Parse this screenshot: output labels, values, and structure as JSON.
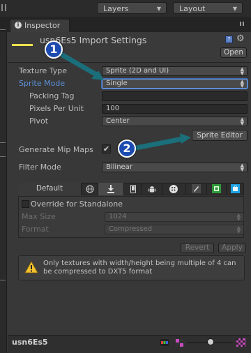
{
  "toolbar": {
    "layers_label": "Layers",
    "layout_label": "Layout"
  },
  "tab": {
    "label": "Inspector"
  },
  "header": {
    "title": "usn6Es5 Import Settings",
    "open_label": "Open"
  },
  "settings": {
    "texture_type": {
      "label": "Texture Type",
      "value": "Sprite (2D and UI)"
    },
    "sprite_mode": {
      "label": "Sprite Mode",
      "value": "Single"
    },
    "packing_tag": {
      "label": "Packing Tag",
      "value": ""
    },
    "pixels_per_unit": {
      "label": "Pixels Per Unit",
      "value": "100"
    },
    "pivot": {
      "label": "Pivot",
      "value": "Center"
    },
    "sprite_editor_label": "Sprite Editor",
    "mip_maps": {
      "label": "Generate Mip Maps",
      "checked": true
    },
    "filter_mode": {
      "label": "Filter Mode",
      "value": "Bilinear"
    }
  },
  "platforms": {
    "default_label": "Default",
    "icons": [
      "globe-icon",
      "download-icon",
      "phone-icon",
      "android-icon",
      "blackberry-icon",
      "flash-icon",
      "xbox-icon",
      "windows-store-icon"
    ]
  },
  "override": {
    "label": "Override for Standalone",
    "max_size": {
      "label": "Max Size",
      "value": "1024"
    },
    "format": {
      "label": "Format",
      "value": "Compressed"
    }
  },
  "actions": {
    "revert_label": "Revert",
    "apply_label": "Apply"
  },
  "help": {
    "message": "Only textures with width/height being multiple of 4 can be compressed to DXT5 format"
  },
  "footer": {
    "asset_name": "usn6Es5"
  },
  "callouts": {
    "one": "1",
    "two": "2"
  },
  "colors": {
    "accent_blue": "#5b8fd6",
    "callout_fill": "#1c4bb0",
    "arrow_teal": "#1a6f7a"
  }
}
